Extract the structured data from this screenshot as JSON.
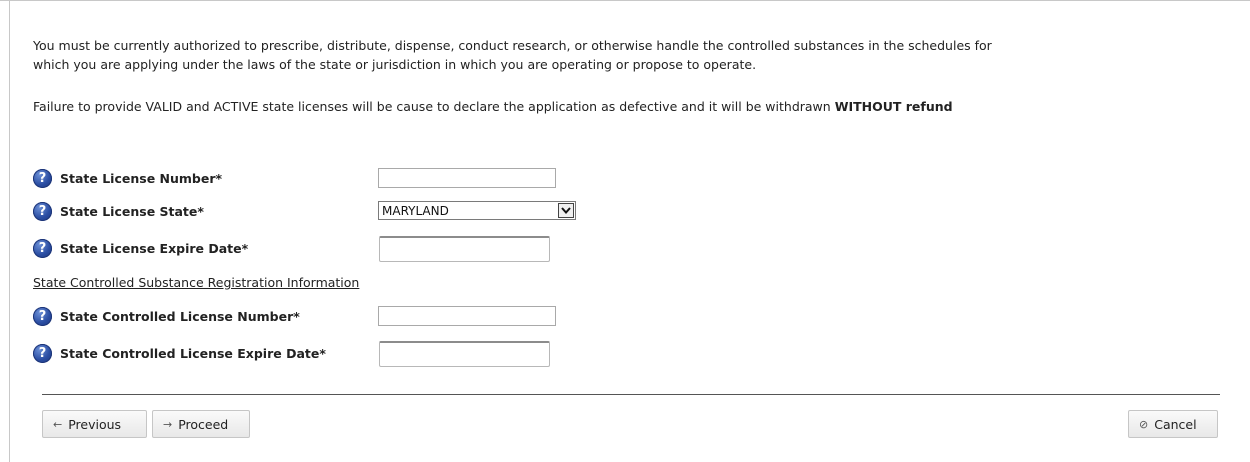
{
  "intro": {
    "paragraph1": "You must be currently authorized to prescribe, distribute, dispense, conduct research, or otherwise handle the controlled substances in the schedules for which you are applying under the laws of the state or jurisdiction in which you are operating or propose to operate.",
    "paragraph2_text": "Failure to provide VALID and ACTIVE state licenses will be cause to declare the application as defective and it will be withdrawn ",
    "paragraph2_bold": "WITHOUT refund"
  },
  "help_icon_glyph": "?",
  "fields": {
    "state_license_number": {
      "label": "State License Number*",
      "value": ""
    },
    "state_license_state": {
      "label": "State License State*",
      "selected": "MARYLAND"
    },
    "state_license_expire": {
      "label": "State License Expire Date*",
      "value": ""
    },
    "controlled_license_number": {
      "label": "State Controlled License Number*",
      "value": ""
    },
    "controlled_license_expire": {
      "label": "State Controlled License Expire Date*",
      "value": ""
    }
  },
  "section_link": "State Controlled Substance Registration Information",
  "buttons": {
    "previous": {
      "glyph": "←",
      "label": "Previous"
    },
    "proceed": {
      "glyph": "→",
      "label": "Proceed"
    },
    "cancel": {
      "glyph": "⊘",
      "label": "Cancel"
    }
  },
  "icons": {
    "help": "help-question-icon",
    "dropdown": "chevron-down-icon"
  },
  "colors": {
    "help_icon": "#2b4ea3",
    "divider": "#555555",
    "frame": "#c8c8c8"
  }
}
